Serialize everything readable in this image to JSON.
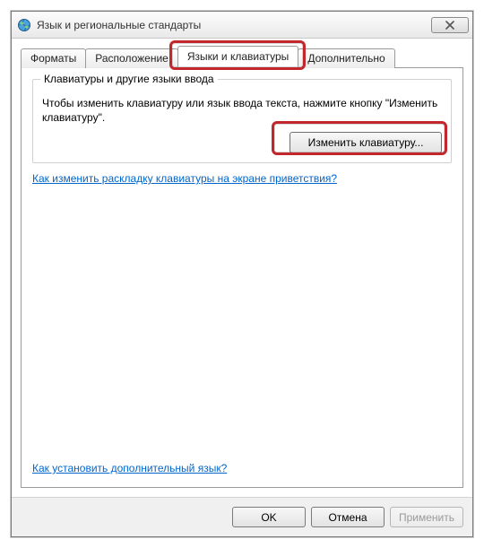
{
  "window": {
    "title": "Язык и региональные стандарты"
  },
  "tabs": {
    "formats": "Форматы",
    "location": "Расположение",
    "languages": "Языки и клавиатуры",
    "advanced": "Дополнительно"
  },
  "group": {
    "legend": "Клавиатуры и другие языки ввода",
    "desc": "Чтобы изменить клавиатуру или язык ввода текста, нажмите кнопку \"Изменить клавиатуру\".",
    "change_button": "Изменить клавиатуру..."
  },
  "links": {
    "welcome_layout": "Как изменить раскладку клавиатуры на экране приветствия?",
    "install_lang": "Как установить дополнительный язык?"
  },
  "buttons": {
    "ok": "OK",
    "cancel": "Отмена",
    "apply": "Применить"
  }
}
